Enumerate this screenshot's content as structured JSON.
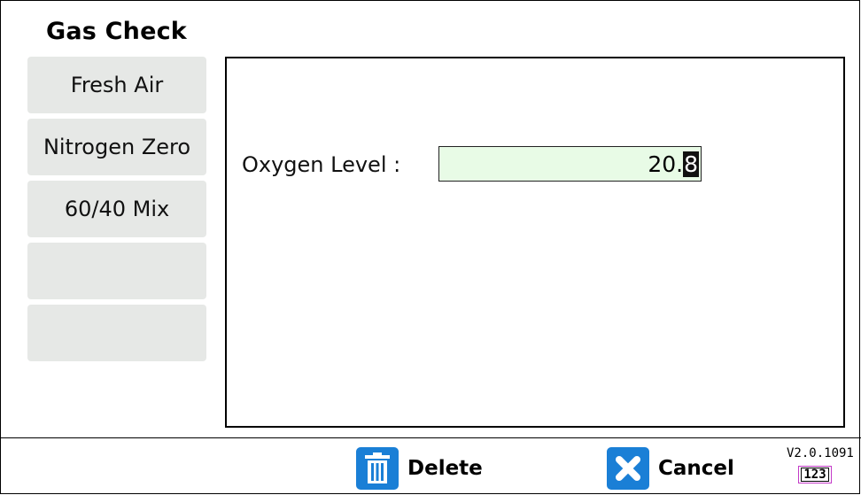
{
  "header": {
    "title": "Gas Check"
  },
  "sidebar": {
    "items": [
      {
        "label": "Fresh Air"
      },
      {
        "label": "Nitrogen Zero"
      },
      {
        "label": "60/40 Mix"
      },
      {
        "label": ""
      },
      {
        "label": ""
      }
    ]
  },
  "form": {
    "oxygen_label": "Oxygen Level :",
    "oxygen_value_prefix": "20.",
    "oxygen_value_selected": "8"
  },
  "footer": {
    "delete_label": "Delete",
    "cancel_label": "Cancel",
    "version": "V2.0.1091",
    "keypad_label": "123"
  },
  "colors": {
    "button_bg": "#e6e8e6",
    "input_bg": "#e8fbe6",
    "icon_blue": "#1a7fd6",
    "keypad_border": "#c33bc8"
  }
}
